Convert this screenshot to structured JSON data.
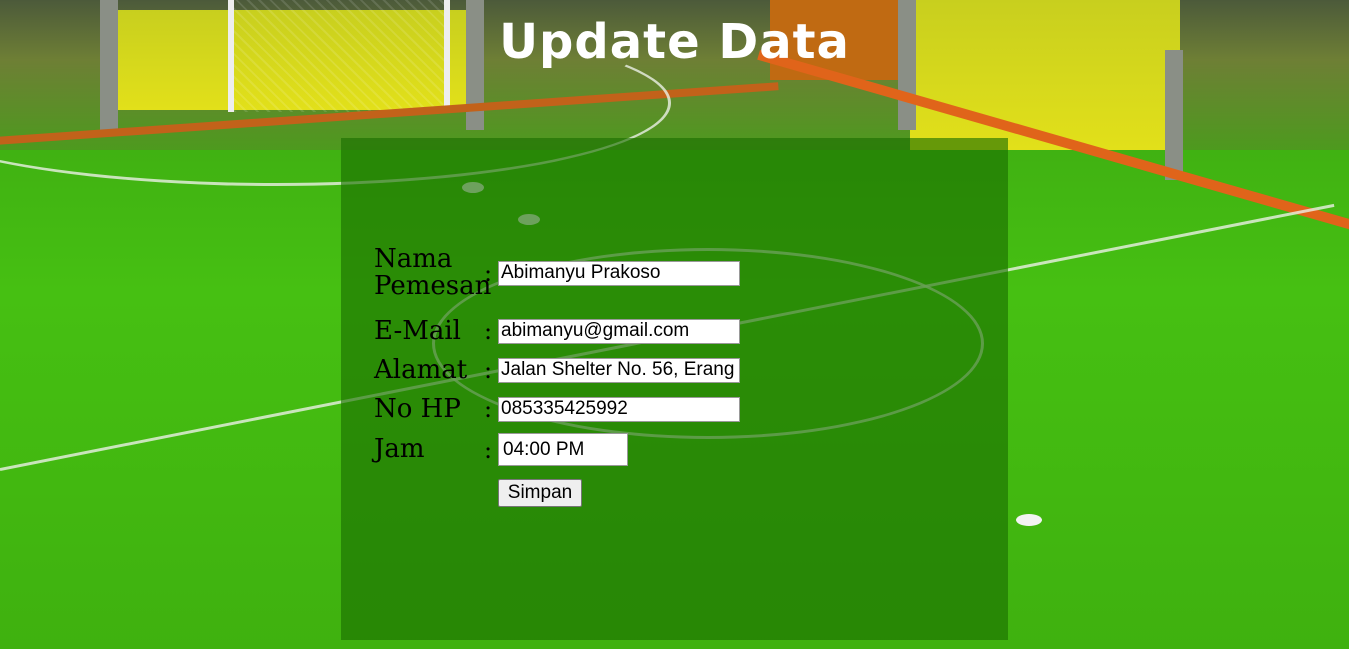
{
  "page": {
    "title": "Update Data"
  },
  "form": {
    "fields": [
      {
        "label": "Nama Pemesan",
        "separator": ":",
        "value": "Abimanyu Prakoso"
      },
      {
        "label": "E-Mail",
        "separator": ":",
        "value": "abimanyu@gmail.com"
      },
      {
        "label": "Alamat",
        "separator": ":",
        "value": "Jalan Shelter No. 56, Erang"
      },
      {
        "label": "No HP",
        "separator": ":",
        "value": "085335425992"
      },
      {
        "label": "Jam",
        "separator": ":",
        "value": "04:00 PM"
      }
    ],
    "submit_label": "Simpan"
  },
  "colors": {
    "panel_overlay": "#1a6e00",
    "title_text": "#ffffff"
  }
}
